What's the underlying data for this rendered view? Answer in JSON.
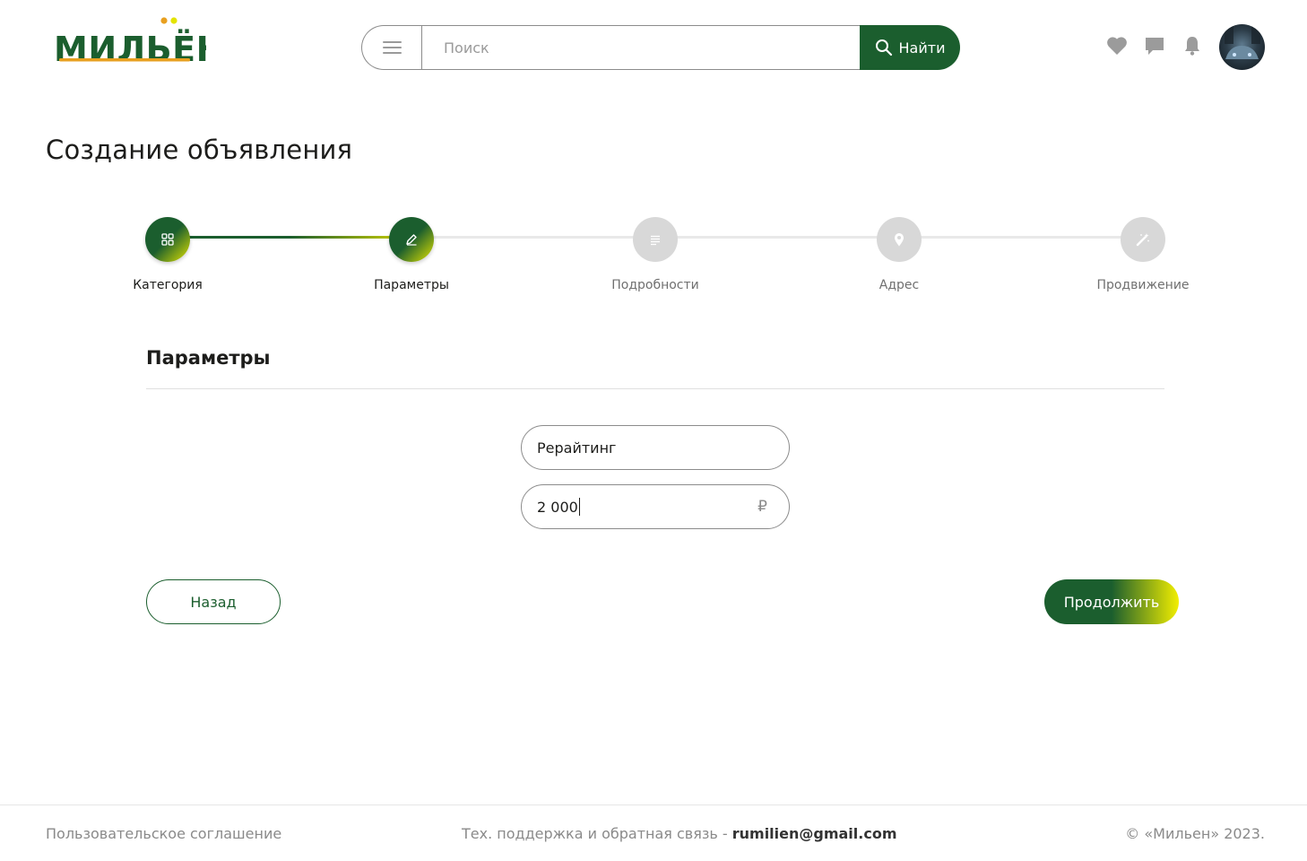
{
  "header": {
    "logo_text": "МИЛЬЁН",
    "search": {
      "placeholder": "Поиск",
      "value": "",
      "button_label": "Найти"
    },
    "icons": [
      "menu-icon",
      "search-icon",
      "heart-icon",
      "chat-icon",
      "bell-icon"
    ]
  },
  "page": {
    "title": "Создание объявления"
  },
  "stepper": {
    "current": 2,
    "steps": [
      {
        "label": "Категория",
        "icon": "grid-icon",
        "state": "completed"
      },
      {
        "label": "Параметры",
        "icon": "pencil-icon",
        "state": "current"
      },
      {
        "label": "Подробности",
        "icon": "lines-icon",
        "state": "upcoming"
      },
      {
        "label": "Адрес",
        "icon": "location-pin-icon",
        "state": "upcoming"
      },
      {
        "label": "Продвижение",
        "icon": "magic-wand-icon",
        "state": "upcoming"
      }
    ]
  },
  "section": {
    "title": "Параметры",
    "fields": [
      {
        "value": "Рерайтинг"
      },
      {
        "value": "2 000",
        "currency": "₽"
      }
    ]
  },
  "actions": {
    "back_label": "Назад",
    "next_label": "Продолжить"
  },
  "footer": {
    "agreement": "Пользовательское соглашение",
    "support_text": "Тех. поддержка и обратная связь - ",
    "support_email": "rumilien@gmail.com",
    "copyright": "© «Мильен» 2023."
  },
  "colors": {
    "brand_green": "#1b5e2e",
    "brand_yellow": "#e3e300",
    "logo_orange": "#e8a020",
    "inactive_step": "#d8d8d8",
    "icon_gray": "#9b9b9b"
  }
}
